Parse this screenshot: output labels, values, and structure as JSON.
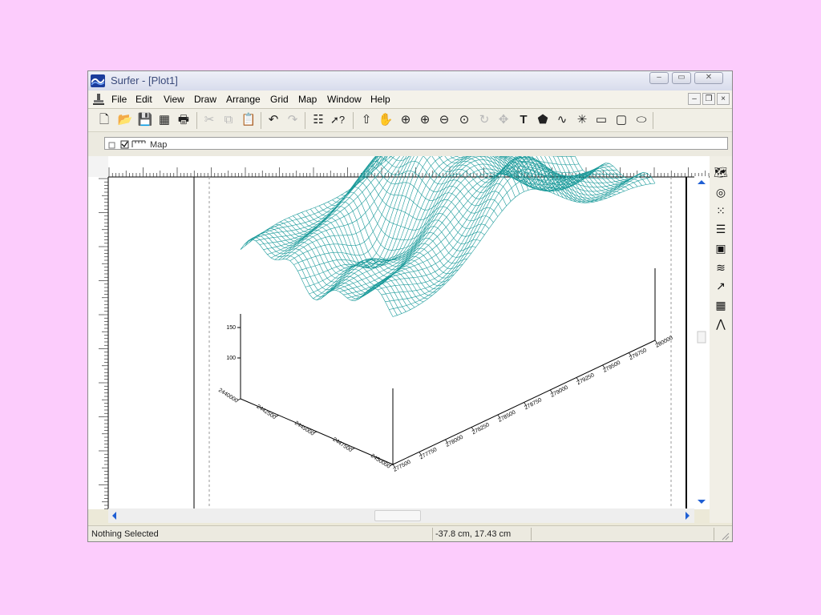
{
  "window": {
    "title": "Surfer - [Plot1]",
    "controls": {
      "minimize": "–",
      "restore": "▭",
      "close": "✕"
    },
    "mdi_controls": {
      "minimize": "–",
      "restore": "❐",
      "close": "×"
    }
  },
  "menu": [
    "File",
    "Edit",
    "View",
    "Draw",
    "Arrange",
    "Grid",
    "Map",
    "Window",
    "Help"
  ],
  "toolbar": [
    {
      "icon": "new-document-icon",
      "glyph": "🗋",
      "enabled": true
    },
    {
      "icon": "open-folder-icon",
      "glyph": "📂",
      "enabled": true
    },
    {
      "icon": "save-icon",
      "glyph": "💾",
      "enabled": true
    },
    {
      "icon": "worksheet-icon",
      "glyph": "▦",
      "enabled": true
    },
    {
      "icon": "print-icon",
      "glyph": "🖶",
      "enabled": true
    },
    {
      "icon": "cut-icon",
      "glyph": "✂",
      "enabled": false
    },
    {
      "icon": "copy-icon",
      "glyph": "⧉",
      "enabled": false
    },
    {
      "icon": "paste-icon",
      "glyph": "📋",
      "enabled": true
    },
    {
      "icon": "undo-icon",
      "glyph": "↶",
      "enabled": true
    },
    {
      "icon": "redo-icon",
      "glyph": "↷",
      "enabled": false
    },
    {
      "icon": "object-manager-icon",
      "glyph": "☷",
      "enabled": true
    },
    {
      "icon": "context-help-icon",
      "glyph": "➚?",
      "enabled": true
    },
    {
      "icon": "select-arrow-icon",
      "glyph": "⇧",
      "enabled": true
    },
    {
      "icon": "pan-hand-icon",
      "glyph": "✋",
      "enabled": true
    },
    {
      "icon": "zoom-rectangle-icon",
      "glyph": "⊕",
      "enabled": true
    },
    {
      "icon": "zoom-in-icon",
      "glyph": "⊕",
      "enabled": true
    },
    {
      "icon": "zoom-out-icon",
      "glyph": "⊖",
      "enabled": true
    },
    {
      "icon": "zoom-page-icon",
      "glyph": "⊙",
      "enabled": true
    },
    {
      "icon": "rotate-icon",
      "glyph": "↻",
      "enabled": false
    },
    {
      "icon": "move-icon",
      "glyph": "✥",
      "enabled": false
    },
    {
      "icon": "text-tool-icon",
      "glyph": "T",
      "enabled": true
    },
    {
      "icon": "polygon-tool-icon",
      "glyph": "⬟",
      "enabled": true
    },
    {
      "icon": "polyline-tool-icon",
      "glyph": "∿",
      "enabled": true
    },
    {
      "icon": "symbol-tool-icon",
      "glyph": "✳",
      "enabled": true
    },
    {
      "icon": "rectangle-tool-icon",
      "glyph": "▭",
      "enabled": true
    },
    {
      "icon": "rounded-rectangle-tool-icon",
      "glyph": "▢",
      "enabled": true
    },
    {
      "icon": "ellipse-tool-icon",
      "glyph": "⬭",
      "enabled": true
    }
  ],
  "object_manager": {
    "item": "Map"
  },
  "map_tools": [
    {
      "icon": "base-map-icon",
      "glyph": "🗺"
    },
    {
      "icon": "contour-map-icon",
      "glyph": "◎"
    },
    {
      "icon": "post-map-icon",
      "glyph": "⁙"
    },
    {
      "icon": "classed-post-map-icon",
      "glyph": "☰"
    },
    {
      "icon": "image-map-icon",
      "glyph": "▣"
    },
    {
      "icon": "shaded-relief-map-icon",
      "glyph": "≋"
    },
    {
      "icon": "vector-map-icon",
      "glyph": "↗"
    },
    {
      "icon": "wireframe-icon",
      "glyph": "▦"
    },
    {
      "icon": "surface-icon",
      "glyph": "⋀"
    }
  ],
  "plot": {
    "z_tick_labels": [
      "150",
      "100"
    ],
    "x_tick_labels": [
      "277500",
      "277750",
      "278000",
      "278250",
      "278500",
      "278750",
      "279000",
      "279250",
      "279500",
      "279750",
      "280000"
    ],
    "y_tick_labels": [
      "2440000",
      "2442500",
      "2445000",
      "2447500",
      "2450000"
    ],
    "wire_color": "#1a9a9a"
  },
  "status": {
    "selection": "Nothing Selected",
    "coordinates": "-37.8 cm, 17.43 cm"
  }
}
